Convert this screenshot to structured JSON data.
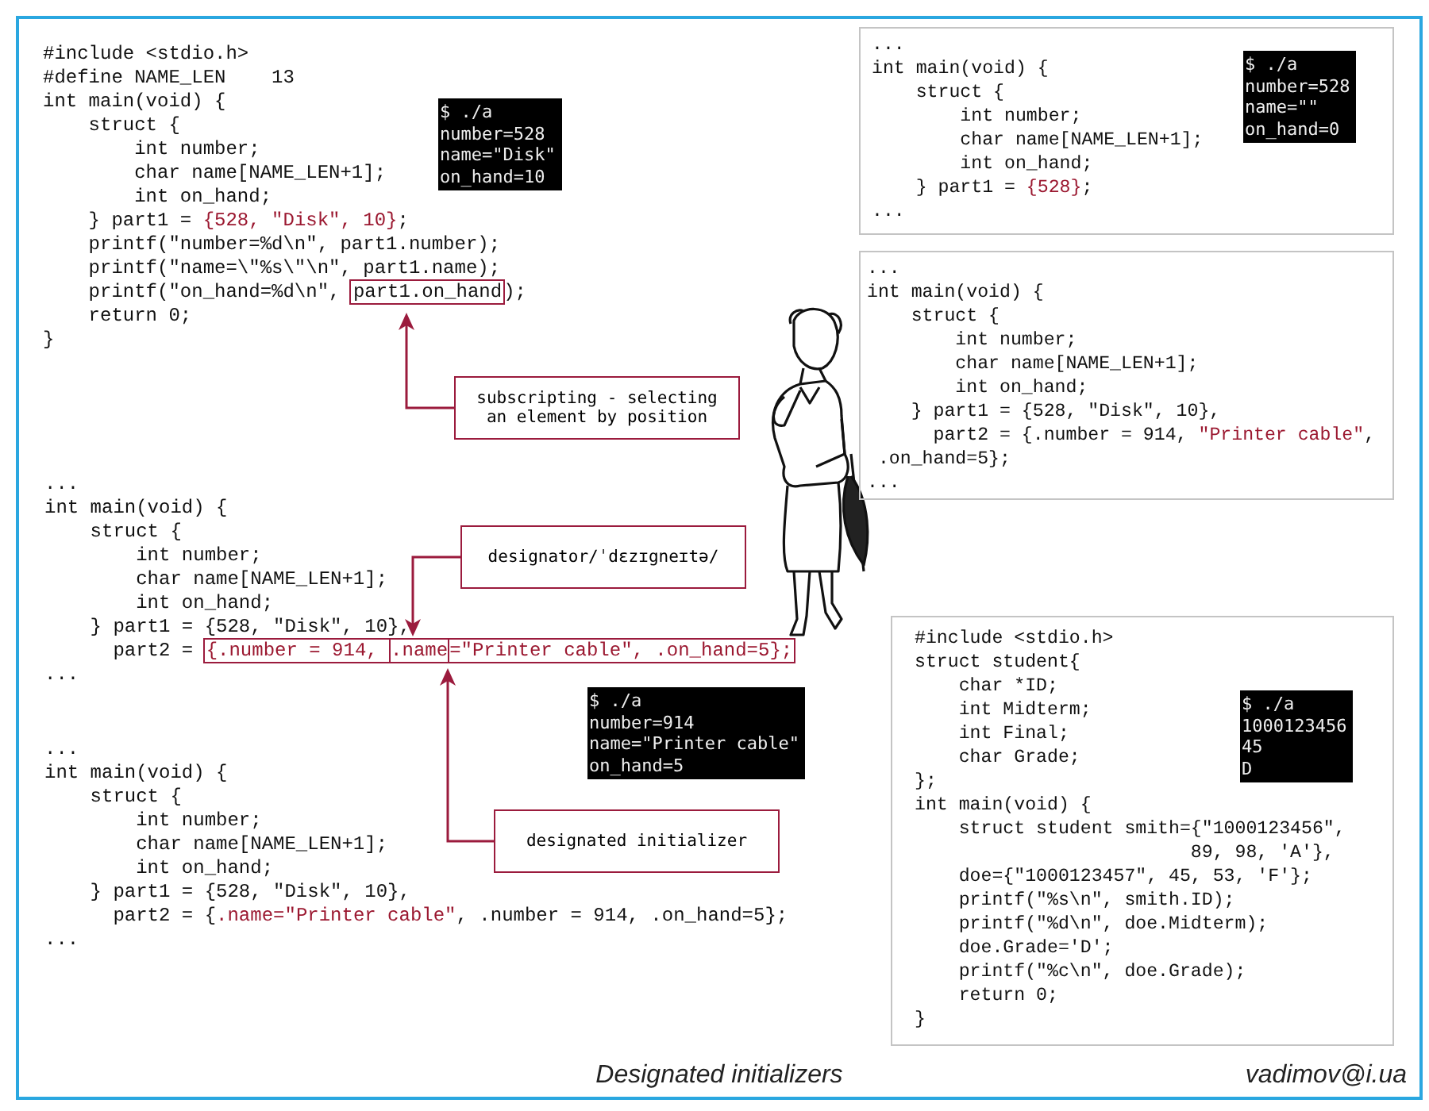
{
  "left_column": {
    "examples": [
      {
        "code": [
          [
            {
              "kind": "code",
              "text": "#include <stdio.h>"
            }
          ],
          [
            {
              "kind": "code",
              "text": "#define NAME_LEN    13"
            }
          ],
          [
            {
              "kind": "code",
              "text": "int main(void) {"
            }
          ],
          [
            {
              "kind": "code",
              "text": "    struct {"
            }
          ],
          [
            {
              "kind": "code",
              "text": "        int number;"
            }
          ],
          [
            {
              "kind": "code",
              "text": "        char name[NAME_LEN+1];"
            }
          ],
          [
            {
              "kind": "code",
              "text": "        int on_hand;"
            }
          ],
          [
            {
              "kind": "code",
              "text": "    } part1 = "
            },
            {
              "kind": "literal",
              "text": "{528, \"Disk\", 10}"
            },
            {
              "kind": "code",
              "text": ";"
            }
          ],
          [
            {
              "kind": "code",
              "text": "    printf(\"number=%d\\n\", part1.number);"
            }
          ],
          [
            {
              "kind": "code",
              "text": "    printf(\"name=\\\"%s\\\"\\n\", part1.name);"
            }
          ],
          [
            {
              "kind": "code",
              "text": "    printf(\"on_hand=%d\\n\", "
            },
            {
              "kind": "box",
              "parts": [
                {
                  "kind": "code",
                  "text": "part1.on_hand"
                }
              ]
            },
            {
              "kind": "code",
              "text": ");"
            }
          ],
          [
            {
              "kind": "code",
              "text": "    return 0;"
            }
          ],
          [
            {
              "kind": "code",
              "text": "}"
            }
          ]
        ]
      },
      {
        "code": [
          [
            {
              "kind": "code",
              "text": "..."
            }
          ],
          [
            {
              "kind": "code",
              "text": "int main(void) {"
            }
          ],
          [
            {
              "kind": "code",
              "text": "    struct {"
            }
          ],
          [
            {
              "kind": "code",
              "text": "        int number;"
            }
          ],
          [
            {
              "kind": "code",
              "text": "        char name[NAME_LEN+1];"
            }
          ],
          [
            {
              "kind": "code",
              "text": "        int on_hand;"
            }
          ],
          [
            {
              "kind": "code",
              "text": "    } part1 = {528, \"Disk\", 10},"
            }
          ],
          [
            {
              "kind": "code",
              "text": "      part2 = "
            },
            {
              "kind": "box",
              "parts": [
                {
                  "kind": "literal",
                  "text": "{.number = 914, "
                },
                {
                  "kind": "box",
                  "parts": [
                    {
                      "kind": "literal",
                      "text": ".name"
                    }
                  ]
                },
                {
                  "kind": "literal",
                  "text": "=\"Printer cable\", .on_hand=5};"
                }
              ]
            }
          ],
          [
            {
              "kind": "code",
              "text": "..."
            }
          ]
        ]
      },
      {
        "code": [
          [
            {
              "kind": "code",
              "text": "..."
            }
          ],
          [
            {
              "kind": "code",
              "text": "int main(void) {"
            }
          ],
          [
            {
              "kind": "code",
              "text": "    struct {"
            }
          ],
          [
            {
              "kind": "code",
              "text": "        int number;"
            }
          ],
          [
            {
              "kind": "code",
              "text": "        char name[NAME_LEN+1];"
            }
          ],
          [
            {
              "kind": "code",
              "text": "        int on_hand;"
            }
          ],
          [
            {
              "kind": "code",
              "text": "    } part1 = {528, \"Disk\", 10},"
            }
          ],
          [
            {
              "kind": "code",
              "text": "      part2 = {"
            },
            {
              "kind": "literal",
              "text": ".name=\"Printer cable\""
            },
            {
              "kind": "code",
              "text": ", .number = 914, .on_hand=5};"
            }
          ],
          [
            {
              "kind": "code",
              "text": "..."
            }
          ]
        ]
      }
    ],
    "outputs": [
      {
        "lines": [
          "$ ./a",
          "number=528",
          "name=\"Disk\"",
          "on_hand=10"
        ]
      },
      {
        "lines": [
          "$ ./a",
          "number=914",
          "name=\"Printer cable\"",
          "on_hand=5"
        ]
      }
    ],
    "callouts": [
      {
        "text": "subscripting - selecting an element by position"
      },
      {
        "text": "designator/ˈdɛzɪgneɪtə/"
      },
      {
        "text": "designated initializer"
      }
    ]
  },
  "right_column": {
    "examples": [
      {
        "code": [
          [
            {
              "kind": "code",
              "text": "..."
            }
          ],
          [
            {
              "kind": "code",
              "text": "int main(void) {"
            }
          ],
          [
            {
              "kind": "code",
              "text": "    struct {"
            }
          ],
          [
            {
              "kind": "code",
              "text": "        int number;"
            }
          ],
          [
            {
              "kind": "code",
              "text": "        char name[NAME_LEN+1];"
            }
          ],
          [
            {
              "kind": "code",
              "text": "        int on_hand;"
            }
          ],
          [
            {
              "kind": "code",
              "text": "    } part1 = "
            },
            {
              "kind": "literal",
              "text": "{528}"
            },
            {
              "kind": "code",
              "text": ";"
            }
          ],
          [
            {
              "kind": "code",
              "text": "..."
            }
          ]
        ],
        "output": [
          "$ ./a",
          "number=528",
          "name=\"\"",
          "on_hand=0"
        ]
      },
      {
        "code": [
          [
            {
              "kind": "code",
              "text": "..."
            }
          ],
          [
            {
              "kind": "code",
              "text": "int main(void) {"
            }
          ],
          [
            {
              "kind": "code",
              "text": "    struct {"
            }
          ],
          [
            {
              "kind": "code",
              "text": "        int number;"
            }
          ],
          [
            {
              "kind": "code",
              "text": "        char name[NAME_LEN+1];"
            }
          ],
          [
            {
              "kind": "code",
              "text": "        int on_hand;"
            }
          ],
          [
            {
              "kind": "code",
              "text": "    } part1 = {528, \"Disk\", 10},"
            }
          ],
          [
            {
              "kind": "code",
              "text": "      part2 = {.number = 914, "
            },
            {
              "kind": "literal",
              "text": "\"Printer cable\""
            },
            {
              "kind": "code",
              "text": ","
            }
          ],
          [
            {
              "kind": "code",
              "text": " .on_hand=5};"
            }
          ],
          [
            {
              "kind": "code",
              "text": "..."
            }
          ]
        ]
      },
      {
        "code": [
          [
            {
              "kind": "code",
              "text": "#include <stdio.h>"
            }
          ],
          [
            {
              "kind": "code",
              "text": "struct student{"
            }
          ],
          [
            {
              "kind": "code",
              "text": "    char *ID;"
            }
          ],
          [
            {
              "kind": "code",
              "text": "    int Midterm;"
            }
          ],
          [
            {
              "kind": "code",
              "text": "    int Final;"
            }
          ],
          [
            {
              "kind": "code",
              "text": "    char Grade;"
            }
          ],
          [
            {
              "kind": "code",
              "text": "};"
            }
          ],
          [
            {
              "kind": "code",
              "text": "int main(void) {"
            }
          ],
          [
            {
              "kind": "code",
              "text": "    struct student smith={\"1000123456\","
            }
          ],
          [
            {
              "kind": "code",
              "text": "                         89, 98, 'A'},"
            }
          ],
          [
            {
              "kind": "code",
              "text": "    doe={\"1000123457\", 45, 53, 'F'};"
            }
          ],
          [
            {
              "kind": "code",
              "text": "    printf(\"%s\\n\", smith.ID);"
            }
          ],
          [
            {
              "kind": "code",
              "text": "    printf(\"%d\\n\", doe.Midterm);"
            }
          ],
          [
            {
              "kind": "code",
              "text": "    doe.Grade='D';"
            }
          ],
          [
            {
              "kind": "code",
              "text": "    printf(\"%c\\n\", doe.Grade);"
            }
          ],
          [
            {
              "kind": "code",
              "text": "    return 0;"
            }
          ],
          [
            {
              "kind": "code",
              "text": "}"
            }
          ]
        ],
        "output": [
          "$ ./a",
          "1000123456",
          "45",
          "D"
        ]
      }
    ]
  },
  "footer": {
    "title": "Designated initializers",
    "author": "vadimov@i.ua"
  }
}
